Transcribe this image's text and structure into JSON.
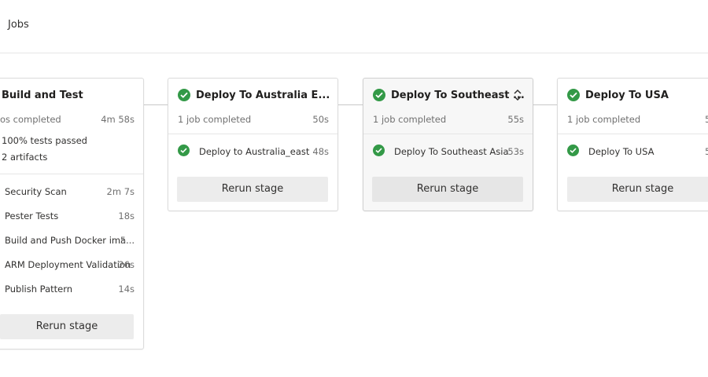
{
  "header": {
    "title": "Jobs"
  },
  "stages": {
    "build": {
      "title": "Build and Test",
      "summary": "os completed",
      "duration": "4m 58s",
      "tests": "100% tests passed",
      "artifacts": "2 artifacts",
      "jobs": [
        {
          "name": "Security Scan",
          "duration": "2m 7s"
        },
        {
          "name": "Pester Tests",
          "duration": "18s"
        },
        {
          "name": "Build and Push Docker ima...",
          "duration": "5..."
        },
        {
          "name": "ARM Deployment Validation",
          "duration": "26s"
        },
        {
          "name": "Publish Pattern",
          "duration": "14s"
        }
      ],
      "rerun_label": "Rerun stage"
    },
    "australia": {
      "title": "Deploy To Australia E...",
      "summary": "1 job completed",
      "duration": "50s",
      "jobs": [
        {
          "name": "Deploy to Australia_east",
          "duration": "48s"
        }
      ],
      "rerun_label": "Rerun stage"
    },
    "sea": {
      "title": "Deploy To Southeast ...",
      "summary": "1 job completed",
      "duration": "55s",
      "jobs": [
        {
          "name": "Deploy To Southeast Asia",
          "duration": "53s"
        }
      ],
      "rerun_label": "Rerun stage"
    },
    "usa": {
      "title": "Deploy To USA",
      "summary": "1 job completed",
      "duration": "5",
      "jobs": [
        {
          "name": "Deploy To USA",
          "duration": "5"
        }
      ],
      "rerun_label": "Rerun stage"
    }
  },
  "colors": {
    "success": "#339947",
    "button_bg": "#ececec",
    "border": "#dcdcdc"
  },
  "icons": {
    "status": "success-check-icon",
    "expand": "expand-collapse-chevron-icon"
  }
}
